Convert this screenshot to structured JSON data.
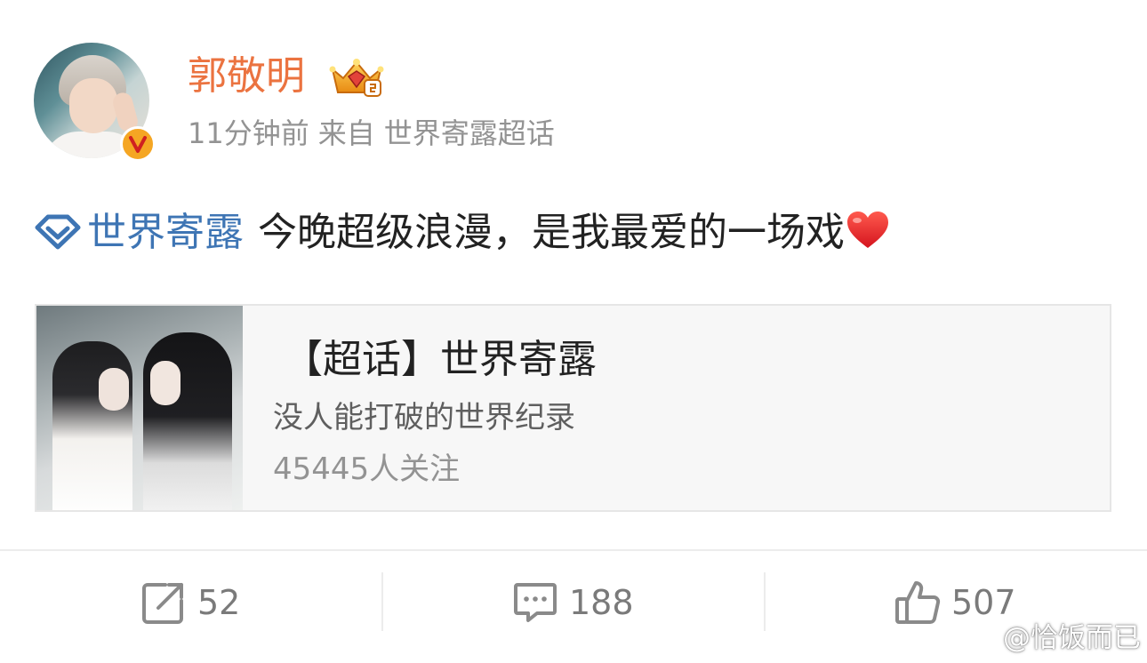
{
  "post": {
    "author": {
      "name": "郭敬明",
      "time": "11分钟前",
      "source_prefix": "来自",
      "source": "世界寄露超话"
    },
    "content": {
      "topic": "世界寄露",
      "text": "今晚超级浪漫，是我最爱的一场戏"
    },
    "card": {
      "title": "【超话】世界寄露",
      "description": "没人能打破的世界纪录",
      "followers": "45445人关注"
    },
    "actions": {
      "repost_count": "52",
      "comment_count": "188",
      "like_count": "507"
    }
  },
  "watermark": {
    "text": "@恰饭而已"
  },
  "icons": {
    "verified": "verified-v-badge",
    "vip": "vip-crown-icon",
    "topic": "super-topic-diamond-icon",
    "heart": "red-heart-emoji",
    "repost": "repost-icon",
    "comment": "comment-icon",
    "like": "thumbs-up-icon",
    "watermark_logo": "weibo-logo-icon"
  },
  "colors": {
    "username": "#eb7340",
    "topic_link": "#3e75b4",
    "meta_text": "#939393",
    "heart": "#e0262c",
    "verified_badge": "#f5a623",
    "card_bg": "#f7f7f7"
  }
}
